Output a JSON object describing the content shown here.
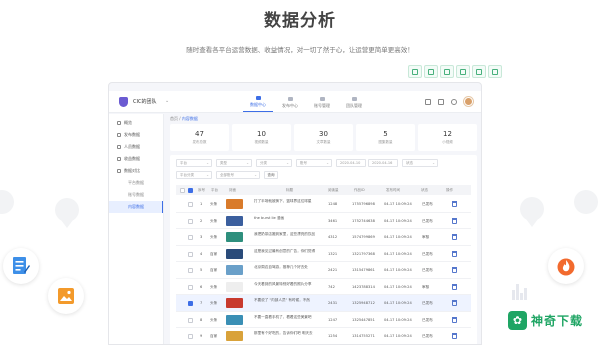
{
  "hero": {
    "title": "数据分析",
    "subtitle": "随时查看各平台运营数据、收益情况，对一切了然于心，让运营更简单更高效！"
  },
  "brand": {
    "mark": "✿",
    "text": "神奇下载"
  },
  "colors": {
    "accent": "#3d6ee6",
    "brand_green": "#1fa564",
    "logo_purple": "#6b5bd2"
  },
  "app": {
    "org_name": "CIC的团队",
    "nav": [
      {
        "label": "数据中心",
        "icon": "chart-icon"
      },
      {
        "label": "发布中心",
        "icon": "send-icon"
      },
      {
        "label": "账号管理",
        "icon": "user-icon"
      },
      {
        "label": "团队管理",
        "icon": "team-icon"
      }
    ],
    "sidebar": [
      {
        "label": "概览"
      },
      {
        "label": "发布数据"
      },
      {
        "label": "人员数据"
      },
      {
        "label": "收益数据"
      },
      {
        "label": "数据对比"
      },
      {
        "label": "平台数据"
      },
      {
        "label": "账号数据"
      },
      {
        "label": "内容数据"
      }
    ],
    "breadcrumb": {
      "root": "首页",
      "sep": " / ",
      "current": "内容数据"
    },
    "stats": [
      {
        "value": "47",
        "label": "发布总数"
      },
      {
        "value": "10",
        "label": "视频数量"
      },
      {
        "value": "30",
        "label": "文章数量"
      },
      {
        "value": "5",
        "label": "图集数量"
      },
      {
        "value": "12",
        "label": "小视频"
      }
    ],
    "filters": {
      "row1": [
        "平台",
        "类型",
        "分类",
        "账号",
        "2020-04-10",
        "2020-04-16",
        "状态"
      ],
      "row2": [
        "平台分类",
        "全部账号"
      ],
      "search_button": "查询"
    },
    "table": {
      "headers": [
        "",
        "序号",
        "平台",
        "封面",
        "标题",
        "阅读量",
        "作品ID",
        "发布时间",
        "状态",
        "操作"
      ],
      "rows": [
        {
          "num": "1",
          "platform": "头条",
          "title": "打了半场就被换下，篮球界这位球星",
          "reads": "1248",
          "id": "1755796898",
          "time": "04-17 10:09:24",
          "status": "已发布",
          "thumb": "#d97b2b"
        },
        {
          "num": "2",
          "platform": "头条",
          "title": "the burst lie 漫画",
          "reads": "3461",
          "id": "1752744638",
          "time": "04-17 10:09:24",
          "status": "已发布",
          "thumb": "#3b5f9e"
        },
        {
          "num": "3",
          "platform": "头条",
          "title": "我把奶茶店搬到家里，这些漂亮的饮品",
          "reads": "4312",
          "id": "1574799869",
          "time": "04-17 10:09:24",
          "status": "审核",
          "thumb": "#2e8f7d"
        },
        {
          "num": "4",
          "platform": "百家",
          "title": "这是我见过最有创意的广告，你们觉得",
          "reads": "1321",
          "id": "1321797368",
          "time": "04-17 10:09:24",
          "status": "已发布",
          "thumb": "#2a4b7a"
        },
        {
          "num": "5",
          "platform": "百家",
          "title": "北京周边自驾游，推荐几个好去处",
          "reads": "2421",
          "id": "1315479861",
          "time": "04-17 10:09:24",
          "status": "已发布",
          "thumb": "#6aa0c9"
        },
        {
          "num": "6",
          "platform": "头条",
          "title": "今天看到的风景特别好看的照片分享",
          "reads": "742",
          "id": "1423788314",
          "time": "04-17 10:09:24",
          "status": "审核",
          "thumb": "#eeeeee"
        },
        {
          "num": "7",
          "platform": "头条",
          "title": "不要说了 \"内部人员\" 有时候，不然",
          "reads": "2431",
          "id": "1325948712",
          "time": "04-17 10:09:24",
          "status": "已发布",
          "thumb": "#c83a2e"
        },
        {
          "num": "8",
          "platform": "头条",
          "title": "不要一直看手机了，看看这些美景吧",
          "reads": "1247",
          "id": "1325447851",
          "time": "04-17 10:09:24",
          "status": "已发布",
          "thumb": "#3a8fb5"
        },
        {
          "num": "9",
          "platform": "百家",
          "title": "那里有个好吃的，告诉你们吧 明天去",
          "reads": "1254",
          "id": "1314755271",
          "time": "04-17 10:09:24",
          "status": "已发布",
          "thumb": "#d9a23a"
        }
      ]
    }
  }
}
